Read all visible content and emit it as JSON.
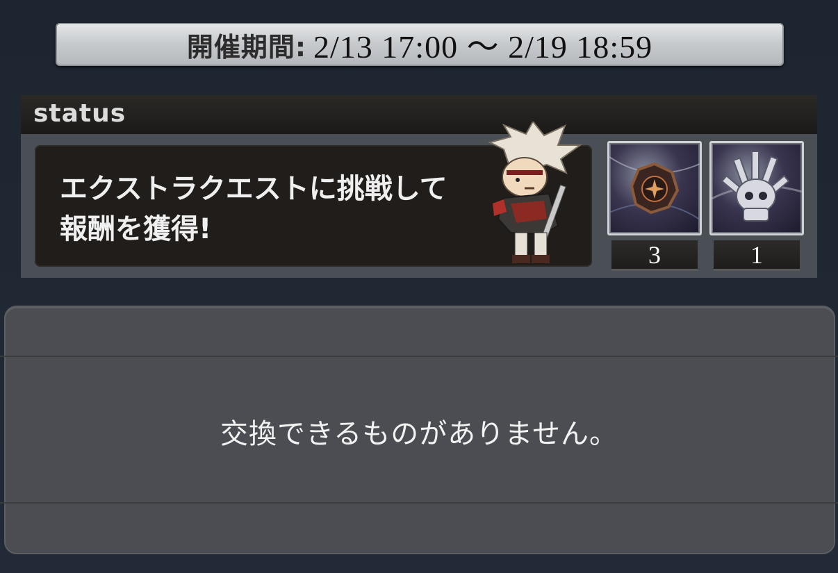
{
  "period": {
    "label": "開催期間:",
    "value": "2/13 17:00 〜 2/19 18:59"
  },
  "status": {
    "title": "status",
    "mission_text": "エクストラクエストに挑戦して\n報酬を獲得!",
    "character_icon": "warrior-character-icon",
    "rewards": [
      {
        "icon": "medal-emblem-icon",
        "count": "3"
      },
      {
        "icon": "spiked-skull-crystal-icon",
        "count": "1"
      }
    ]
  },
  "exchange": {
    "empty_message": "交換できるものがありません。"
  },
  "colors": {
    "background": "#1f2833",
    "panel": "#4a4f56",
    "banner": "#c8cbce"
  }
}
